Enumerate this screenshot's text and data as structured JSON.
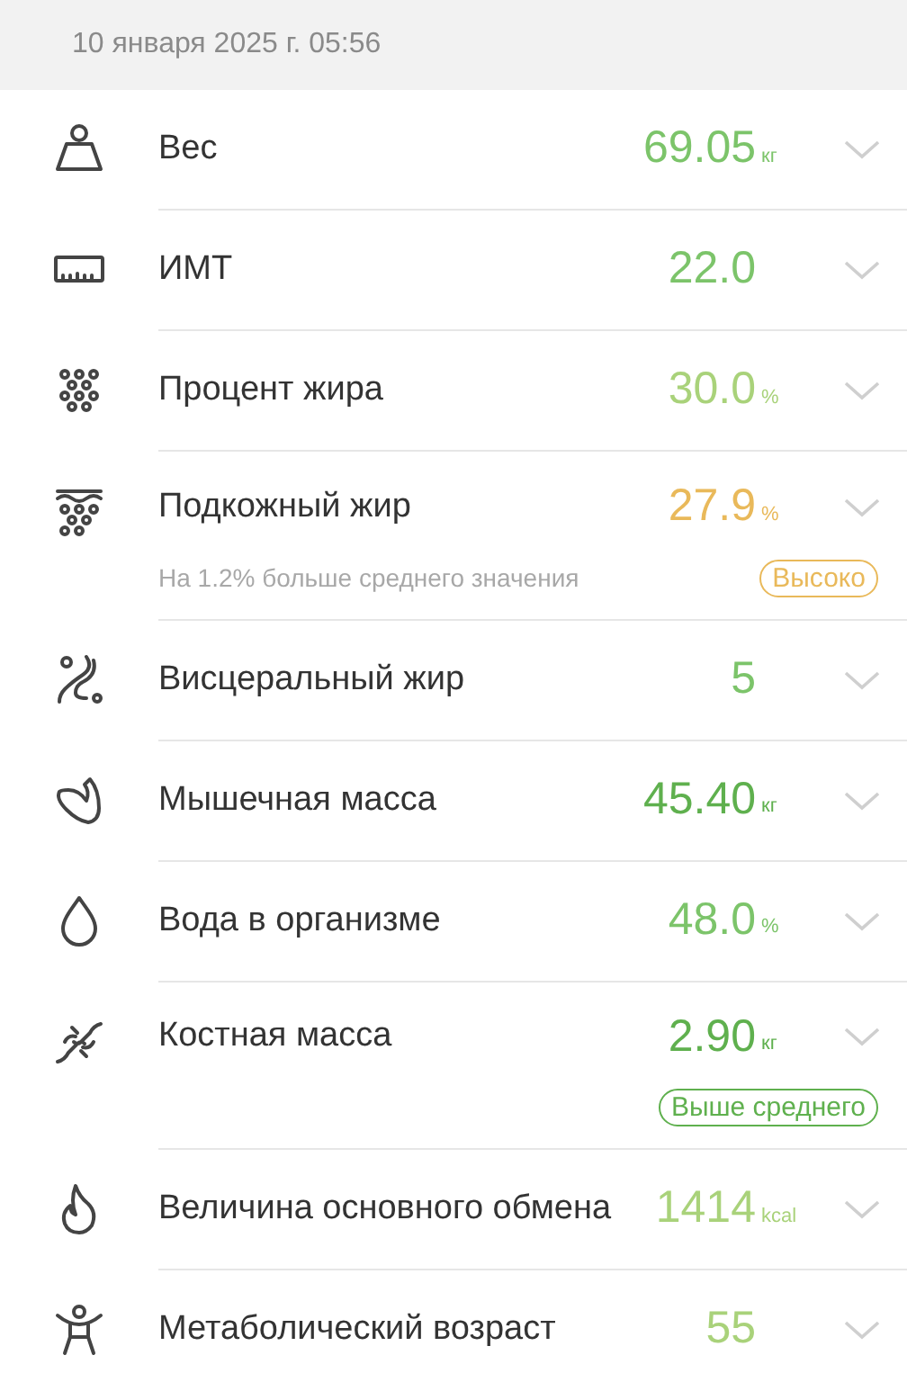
{
  "header": {
    "date": "10 января 2025 г. 05:56"
  },
  "metrics": [
    {
      "label": "Вес",
      "value": "69.05",
      "unit": "кг",
      "color": "#7cc46a"
    },
    {
      "label": "ИМТ",
      "value": "22.0",
      "color": "#7cc46a"
    },
    {
      "label": "Процент жира",
      "value": "30.0",
      "unit": "%",
      "color": "#a9d27a"
    },
    {
      "label": "Подкожный жир",
      "value": "27.9",
      "unit": "%",
      "color": "#e9b95a",
      "note": "На 1.2% больше среднего значения",
      "badge": {
        "text": "Высоко",
        "color": "#e9b95a"
      }
    },
    {
      "label": "Висцеральный жир",
      "value": "5",
      "color": "#7cc46a"
    },
    {
      "label": "Мышечная масса",
      "value": "45.40",
      "unit": "кг",
      "color": "#5fb04e"
    },
    {
      "label": "Вода в организме",
      "value": "48.0",
      "unit": "%",
      "color": "#7cc46a"
    },
    {
      "label": "Костная масса",
      "value": "2.90",
      "unit": "кг",
      "color": "#5fb04e",
      "badge": {
        "text": "Выше среднего",
        "color": "#5fb04e"
      }
    },
    {
      "label": "Величина основного обмена",
      "value": "1414",
      "unit": "kcal",
      "color": "#a9d27a"
    },
    {
      "label": "Метаболический возраст",
      "value": "55",
      "color": "#a9d27a"
    }
  ]
}
